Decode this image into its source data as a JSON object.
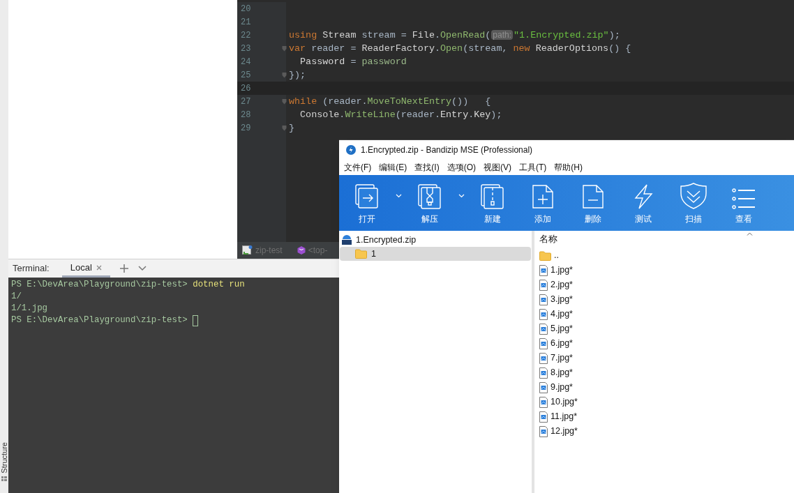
{
  "sidebar": {
    "structure_label": "Structure"
  },
  "editor": {
    "lines": [
      {
        "number": "20",
        "current": false,
        "fold": false
      },
      {
        "number": "21",
        "current": false,
        "fold": false
      },
      {
        "number": "22",
        "current": false,
        "fold": false,
        "tokens": [
          {
            "kind": "kw",
            "text": "using "
          },
          {
            "kind": "type",
            "text": "Stream"
          },
          {
            "kind": "ident",
            "text": " stream"
          },
          {
            "kind": "punct",
            "text": " = "
          },
          {
            "kind": "type",
            "text": "File"
          },
          {
            "kind": "punct",
            "text": "."
          },
          {
            "kind": "method",
            "text": "OpenRead"
          },
          {
            "kind": "punct",
            "text": "("
          },
          {
            "kind": "hint",
            "text": "path:"
          },
          {
            "kind": "string",
            "text": "\"1.Encrypted.zip\""
          },
          {
            "kind": "punct",
            "text": ");"
          }
        ]
      },
      {
        "number": "23",
        "current": false,
        "fold": true,
        "tokens": [
          {
            "kind": "kw",
            "text": "var "
          },
          {
            "kind": "ident",
            "text": "reader"
          },
          {
            "kind": "punct",
            "text": " = "
          },
          {
            "kind": "type",
            "text": "ReaderFactory"
          },
          {
            "kind": "punct",
            "text": "."
          },
          {
            "kind": "method",
            "text": "Open"
          },
          {
            "kind": "punct",
            "text": "("
          },
          {
            "kind": "ident",
            "text": "stream"
          },
          {
            "kind": "punct",
            "text": ", "
          },
          {
            "kind": "kw",
            "text": "new "
          },
          {
            "kind": "type",
            "text": "ReaderOptions"
          },
          {
            "kind": "punct",
            "text": "() {"
          }
        ]
      },
      {
        "number": "24",
        "current": false,
        "fold": false,
        "tokens": [
          {
            "kind": "prop",
            "text": "  Password"
          },
          {
            "kind": "punct",
            "text": " = "
          },
          {
            "kind": "local",
            "text": "password"
          }
        ]
      },
      {
        "number": "25",
        "current": false,
        "fold": true,
        "tokens": [
          {
            "kind": "punct",
            "text": "});"
          }
        ]
      },
      {
        "number": "26",
        "current": true,
        "fold": false
      },
      {
        "number": "27",
        "current": false,
        "fold": true,
        "tokens": [
          {
            "kind": "kw",
            "text": "while "
          },
          {
            "kind": "punct",
            "text": "("
          },
          {
            "kind": "ident",
            "text": "reader"
          },
          {
            "kind": "punct",
            "text": "."
          },
          {
            "kind": "method",
            "text": "MoveToNextEntry"
          },
          {
            "kind": "punct",
            "text": "())   {"
          }
        ]
      },
      {
        "number": "28",
        "current": false,
        "fold": false,
        "tokens": [
          {
            "kind": "type",
            "text": "  Console"
          },
          {
            "kind": "punct",
            "text": "."
          },
          {
            "kind": "method",
            "text": "WriteLine"
          },
          {
            "kind": "punct",
            "text": "("
          },
          {
            "kind": "ident",
            "text": "reader"
          },
          {
            "kind": "punct",
            "text": "."
          },
          {
            "kind": "prop",
            "text": "Entry"
          },
          {
            "kind": "punct",
            "text": "."
          },
          {
            "kind": "prop",
            "text": "Key"
          },
          {
            "kind": "punct",
            "text": ");"
          }
        ]
      },
      {
        "number": "29",
        "current": false,
        "fold": true,
        "tokens": [
          {
            "kind": "punct",
            "text": "}"
          }
        ]
      }
    ],
    "breadcrumbs": [
      "zip-test",
      "<top-"
    ]
  },
  "terminal": {
    "label": "Terminal:",
    "tabs": [
      {
        "label": "Local",
        "selected": true
      }
    ],
    "lines": [
      {
        "cursor": false,
        "segments": [
          {
            "kind": "text",
            "text": "PS E:\\DevArea\\Playground\\zip-test> "
          },
          {
            "kind": "command",
            "text": "dotnet run"
          }
        ]
      },
      {
        "cursor": false,
        "segments": [
          {
            "kind": "text",
            "text": "1/"
          }
        ]
      },
      {
        "cursor": false,
        "segments": [
          {
            "kind": "text",
            "text": "1/1.jpg"
          }
        ]
      },
      {
        "cursor": true,
        "segments": [
          {
            "kind": "text",
            "text": "PS E:\\DevArea\\Playground\\zip-test> "
          }
        ]
      }
    ]
  },
  "bandizip": {
    "title": "1.Encrypted.zip - Bandizip MSE (Professional)",
    "menu": [
      "文件(F)",
      "编辑(E)",
      "查找(I)",
      "选项(O)",
      "视图(V)",
      "工具(T)",
      "帮助(H)"
    ],
    "toolbar": [
      {
        "label": "打开",
        "dropdown": true
      },
      {
        "label": "解压",
        "dropdown": true
      },
      {
        "label": "新建",
        "dropdown": false
      },
      {
        "label": "添加",
        "dropdown": false
      },
      {
        "label": "删除",
        "dropdown": false
      },
      {
        "label": "测试",
        "dropdown": false
      },
      {
        "label": "扫描",
        "dropdown": false
      },
      {
        "label": "查看",
        "dropdown": false
      }
    ],
    "tree": {
      "label": "1.Encrypted.zip",
      "children": [
        {
          "label": "1",
          "selected": true
        }
      ]
    },
    "list": {
      "column": "名称",
      "items": [
        {
          "kind": "folder",
          "name": ".."
        },
        {
          "kind": "file",
          "name": "1.jpg*"
        },
        {
          "kind": "file",
          "name": "2.jpg*"
        },
        {
          "kind": "file",
          "name": "3.jpg*"
        },
        {
          "kind": "file",
          "name": "4.jpg*"
        },
        {
          "kind": "file",
          "name": "5.jpg*"
        },
        {
          "kind": "file",
          "name": "6.jpg*"
        },
        {
          "kind": "file",
          "name": "7.jpg*"
        },
        {
          "kind": "file",
          "name": "8.jpg*"
        },
        {
          "kind": "file",
          "name": "9.jpg*"
        },
        {
          "kind": "file",
          "name": "10.jpg*"
        },
        {
          "kind": "file",
          "name": "11.jpg*"
        },
        {
          "kind": "file",
          "name": "12.jpg*"
        }
      ]
    }
  }
}
